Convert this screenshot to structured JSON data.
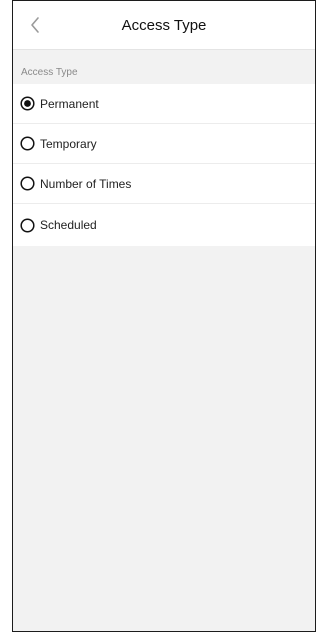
{
  "nav": {
    "title": "Access Type",
    "back_icon": "chevron-left-icon"
  },
  "section": {
    "label": "Access Type"
  },
  "options": [
    {
      "label": "Permanent",
      "selected": true
    },
    {
      "label": "Temporary",
      "selected": false
    },
    {
      "label": "Number of Times",
      "selected": false
    },
    {
      "label": "Scheduled",
      "selected": false
    }
  ],
  "colors": {
    "background": "#f2f2f2",
    "surface": "#ffffff",
    "text": "#222222",
    "secondary_text": "#8a8a8a",
    "radio": "#111111"
  }
}
